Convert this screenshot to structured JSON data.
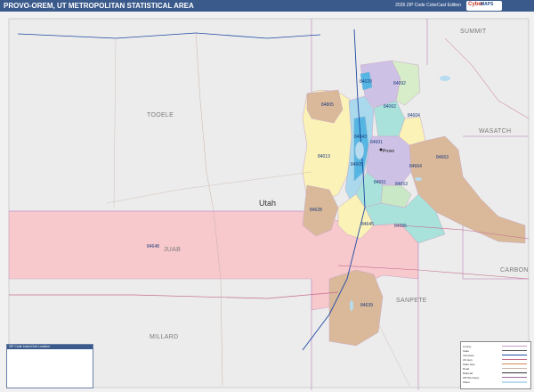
{
  "header": {
    "title": "PROVO-OREM, UT METROPOLITAN STATISTICAL AREA",
    "edition": "2026 ZIP Code ColorCast Edition",
    "logo_a": "Cyber",
    "logo_b": "MAPS"
  },
  "map": {
    "county_labels": [
      "TOOELE",
      "SUMMIT",
      "WASATCH",
      "JUAB",
      "CARBON",
      "SANPETE",
      "MILLARD"
    ],
    "main_label": "Utah",
    "zip_labels": [
      "84029",
      "84092",
      "84062",
      "84604",
      "84805",
      "84043",
      "84601",
      "84013",
      "84663",
      "84664",
      "84651",
      "84653",
      "84628",
      "84645",
      "84655",
      "84648",
      "84639",
      "84605"
    ],
    "city_labels": [
      "Provo"
    ],
    "colors": {
      "pink": "#f7c8cc",
      "tan": "#d9b99a",
      "yellow": "#fbf2b8",
      "lightblue": "#aad8ec",
      "blue": "#56b6e3",
      "green": "#c9e8c6",
      "teal": "#a8e2db",
      "lavender": "#cdc2e6",
      "water": "#b7dcef",
      "county_line": "#c9a8c6",
      "interstate": "#1d4aa3",
      "highway": "#c56b8f",
      "road": "#c9b5a8"
    }
  },
  "legend": {
    "items": [
      "County",
      "State",
      "Interstate",
      "US Hwy",
      "State Hwy",
      "Road",
      "Railroad",
      "ZIP Boundary",
      "Water"
    ]
  },
  "ziptable": {
    "title": "ZIP Code Index/Grid Location"
  }
}
